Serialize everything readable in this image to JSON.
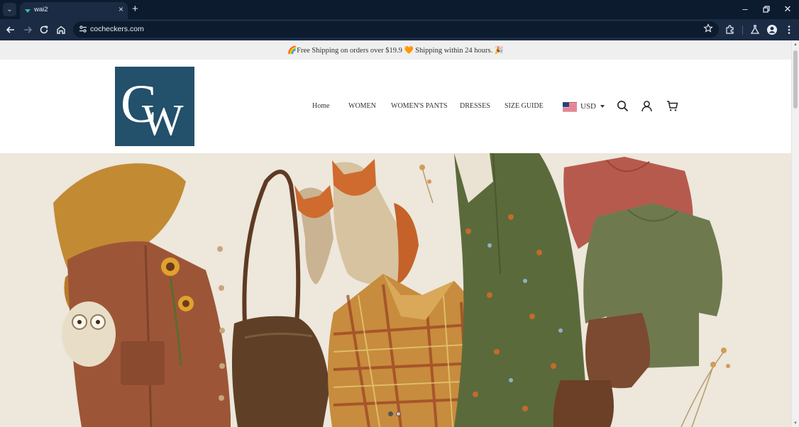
{
  "browser": {
    "tab_title": "wai2",
    "url": "cocheckers.com",
    "icons": [
      "tab-list-icon",
      "new-tab-icon",
      "minimize-icon",
      "restore-icon",
      "close-window-icon",
      "back-icon",
      "forward-icon",
      "reload-icon",
      "home-icon",
      "site-info-icon",
      "bookmark-star-icon",
      "extensions-icon",
      "labs-icon",
      "profile-icon",
      "more-menu-icon"
    ]
  },
  "announcement": {
    "text": "🌈Free Shipping on orders over $19.9 🧡 Shipping within 24 hours. 🎉"
  },
  "header": {
    "logo_text": "CW",
    "nav": [
      "Home",
      "WOMEN",
      "WOMEN'S PANTS",
      "DRESSES",
      "SIZE GUIDE"
    ],
    "currency": "USD",
    "icons": [
      "us-flag-icon",
      "search-icon",
      "account-icon",
      "cart-icon"
    ]
  },
  "hero": {
    "slides": 2,
    "active_slide": 1
  },
  "colors": {
    "chrome_dark": "#0d1b2f",
    "chrome_toolbar": "#1b2b44",
    "logo_bg": "#23506b",
    "announcement_bg": "#efefef"
  }
}
